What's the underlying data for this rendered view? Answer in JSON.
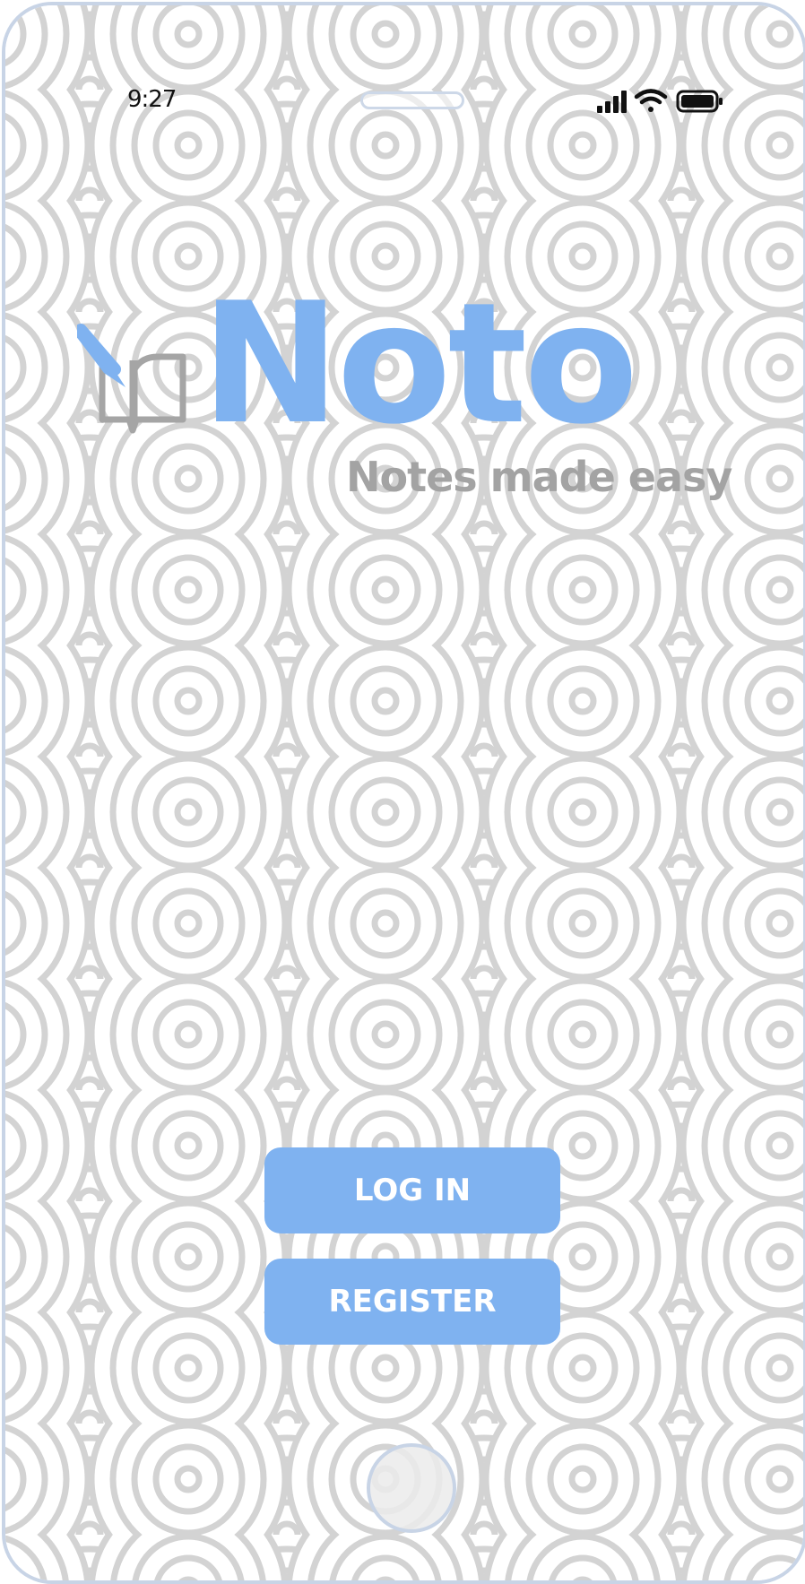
{
  "status_bar": {
    "time": "9:27",
    "icons": [
      "signal-icon",
      "wifi-icon",
      "battery-icon"
    ]
  },
  "brand": {
    "name": "Noto",
    "tagline": "Notes made easy",
    "logo_icon": "book-pen-icon",
    "primary_color": "#7fb2f0",
    "secondary_color": "#a3a3a3"
  },
  "actions": {
    "login_label": "LOG IN",
    "register_label": "REGISTER"
  },
  "device": {
    "frame_color": "#c8d4e6",
    "background_pattern": "seigaiha-waves"
  }
}
